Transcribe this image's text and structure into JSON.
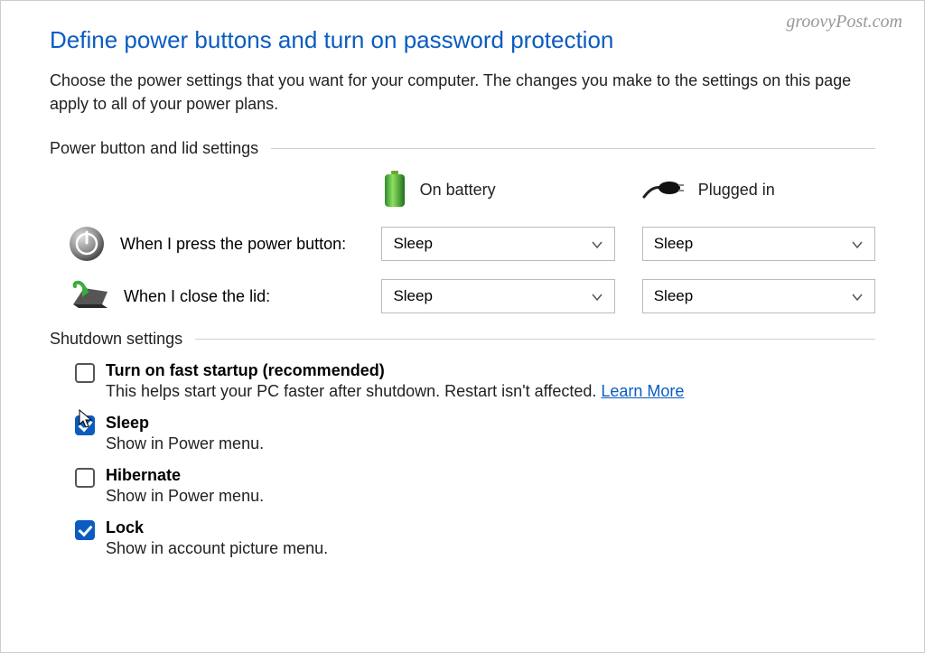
{
  "watermark": "groovyPost.com",
  "title": "Define power buttons and turn on password protection",
  "description": "Choose the power settings that you want for your computer. The changes you make to the settings on this page apply to all of your power plans.",
  "sections": {
    "power_lid": {
      "header": "Power button and lid settings",
      "columns": {
        "battery": "On battery",
        "plugged": "Plugged in"
      },
      "rows": [
        {
          "label": "When I press the power button:",
          "battery_value": "Sleep",
          "plugged_value": "Sleep"
        },
        {
          "label": "When I close the lid:",
          "battery_value": "Sleep",
          "plugged_value": "Sleep"
        }
      ]
    },
    "shutdown": {
      "header": "Shutdown settings",
      "options": [
        {
          "title": "Turn on fast startup (recommended)",
          "desc": "This helps start your PC faster after shutdown. Restart isn't affected. ",
          "link": "Learn More",
          "checked": false
        },
        {
          "title": "Sleep",
          "desc": "Show in Power menu.",
          "checked": true
        },
        {
          "title": "Hibernate",
          "desc": "Show in Power menu.",
          "checked": false
        },
        {
          "title": "Lock",
          "desc": "Show in account picture menu.",
          "checked": true
        }
      ]
    }
  }
}
